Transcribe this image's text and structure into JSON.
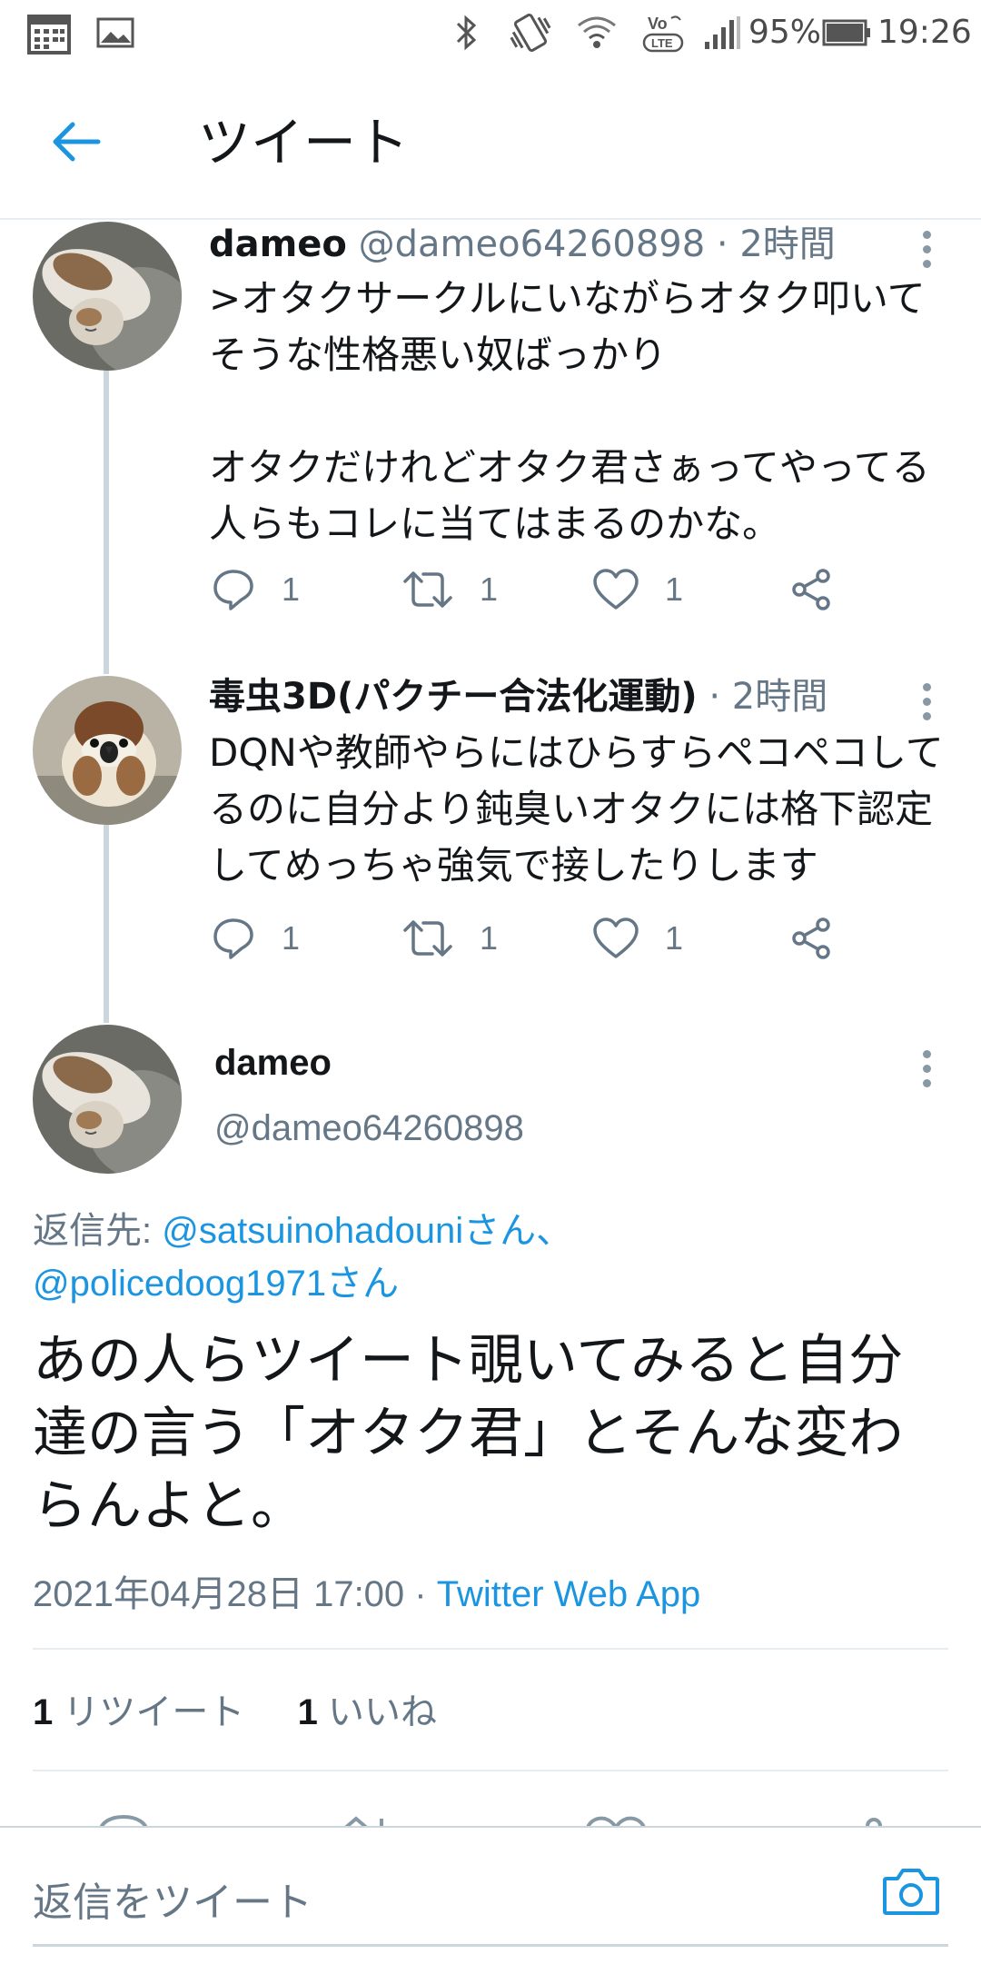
{
  "status_bar": {
    "battery": "95%",
    "time": "19:26",
    "icons": [
      "calendar-icon",
      "image-icon",
      "bluetooth-icon",
      "vibrate-icon",
      "wifi-icon",
      "volte-icon",
      "signal-icon",
      "battery-icon"
    ]
  },
  "header": {
    "title": "ツイート"
  },
  "thread": [
    {
      "name": "dameo",
      "handle": "@dameo64260898",
      "time": "· 2時間",
      "text": [
        ">オタクサークルにいながらオタク叩いてそうな性格悪い奴ばっかり",
        "",
        "オタクだけれどオタク君さぁってやってる人らもコレに当てはまるのかな。"
      ],
      "replies": "1",
      "retweets": "1",
      "likes": "1"
    },
    {
      "name": "毒虫3D(パクチー合法化運動)",
      "handle": "",
      "time": "· 2時間",
      "text": [
        "DQNや教師やらにはひらすらペコペコしてるのに自分より鈍臭いオタクには格下認定してめっちゃ強気で接したりします"
      ],
      "replies": "1",
      "retweets": "1",
      "likes": "1"
    }
  ],
  "main_tweet": {
    "name": "dameo",
    "handle": "@dameo64260898",
    "reply_prefix": "返信先: ",
    "mention1": "@satsuinohadouniさん、",
    "mention2": "@policedoog1971さん",
    "text": [
      "あの人らツイート覗いてみると自分達の言う「オタク君」とそんな変わらんよと。"
    ],
    "date": "2021年04月28日 17:00 · ",
    "app": "Twitter Web App",
    "retweet_count": "1",
    "retweet_label": " リツイート",
    "like_count": "1",
    "like_label": " いいね"
  },
  "composer": {
    "placeholder": "返信をツイート"
  },
  "colors": {
    "accent": "#1b95e0",
    "secondary_text": "#657786",
    "divider": "#e6ecf0"
  }
}
